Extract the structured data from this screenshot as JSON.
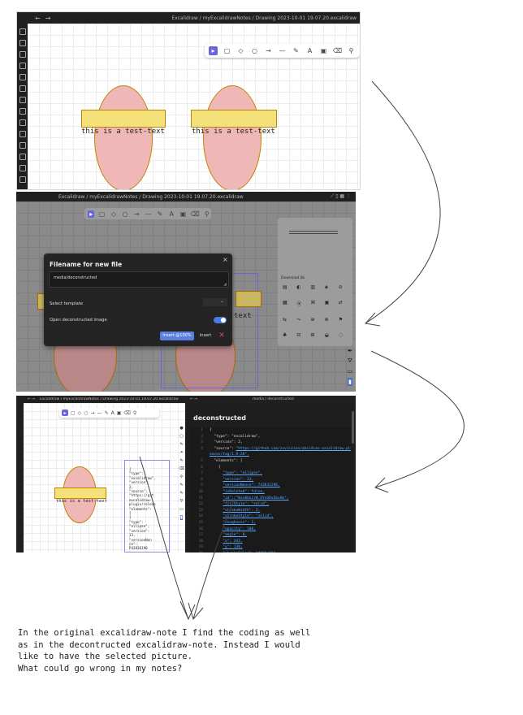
{
  "shot1": {
    "breadcrumb": "Excalidraw / myExcalidrawNotes / Drawing 2023-10-01 19.07.20.excalidraw",
    "labels": [
      "this is a test-text",
      "this is a test-text"
    ]
  },
  "shot2": {
    "breadcrumb": "Excalidraw / myExcalidrawNotes / Drawing 2023-10-01 19.07.20.excalidraw",
    "dialog": {
      "title": "Filename for new file",
      "value": "media/deconstructed",
      "template_label": "Select template",
      "open_label": "Open deconstructed image",
      "insert100": "Insert @100%",
      "insert": "Insert",
      "close": "×"
    },
    "partial_text": "text",
    "panel_heading": "Download lib"
  },
  "shot3": {
    "breadcrumb": "Excalidraw / myExcalidrawNotes / Drawing 2023-10-01 19.07.20.excalidraw",
    "right_title": "media / deconstructed",
    "label": "this is a test-text",
    "doc_title": "deconstructed",
    "code_left": [
      "{",
      "\"type\":",
      "\"excalidraw\",",
      "\"version\":",
      "2,",
      "\"source\":",
      "\"https://git",
      "excalidraw-",
      "plugin/releas",
      "\"elements\":",
      "[",
      "{",
      "\"type\":",
      "\"ellipse\",",
      "\"version\":",
      "13,",
      "\"versionNon",
      "ce\":",
      "P43836190"
    ],
    "json": [
      {
        "n": "1",
        "t": "{"
      },
      {
        "n": "2",
        "t": "  \"type\": \"excalidraw\","
      },
      {
        "n": "3",
        "t": "  \"version\": 2,"
      },
      {
        "n": "4",
        "t": "  \"source\": ",
        "link": "\"https://github.com/zsviczian/obsidian-excalidraw-plugin/rel"
      },
      {
        "n": "",
        "t": "",
        "link": "eases/tag/1.9.20\","
      },
      {
        "n": "5",
        "t": "  \"elements\": ["
      },
      {
        "n": "6",
        "t": "    {"
      },
      {
        "n": "7",
        "t": "      ",
        "link": "\"type\": \"ellipse\","
      },
      {
        "n": "8",
        "t": "      ",
        "link": "\"version\": 13,"
      },
      {
        "n": "9",
        "t": "      ",
        "link": "\"versionNonce\": 743831296,"
      },
      {
        "n": "10",
        "t": "      ",
        "link": "\"isDeleted\": false,"
      },
      {
        "n": "11",
        "t": "      ",
        "link": "\"id\": \"Wsv8Ux1rW_OYnGRsEbuVm\","
      },
      {
        "n": "12",
        "t": "      ",
        "link": "\"fillStyle\": \"solid\","
      },
      {
        "n": "13",
        "t": "      ",
        "link": "\"strokeWidth\": 2,"
      },
      {
        "n": "14",
        "t": "      ",
        "link": "\"strokeStyle\": \"solid\","
      },
      {
        "n": "15",
        "t": "      ",
        "link": "\"roughness\": 1,"
      },
      {
        "n": "16",
        "t": "      ",
        "link": "\"opacity\": 100,"
      },
      {
        "n": "17",
        "t": "      ",
        "link": "\"angle\": 0,"
      },
      {
        "n": "18",
        "t": "      ",
        "link": "\"x\": 343,"
      },
      {
        "n": "19",
        "t": "      ",
        "link": "\"y\": 130,"
      },
      {
        "n": "20",
        "t": "      ",
        "link": "\"strokeColor\": \"#f08c00\","
      }
    ]
  },
  "note": {
    "lines": [
      "In the original excalidraw-note I find the coding as well",
      "as in the decontructed excalidraw-note. Instead I would",
      "like to have the selected picture.",
      "What could go wrong in my notes?"
    ]
  }
}
